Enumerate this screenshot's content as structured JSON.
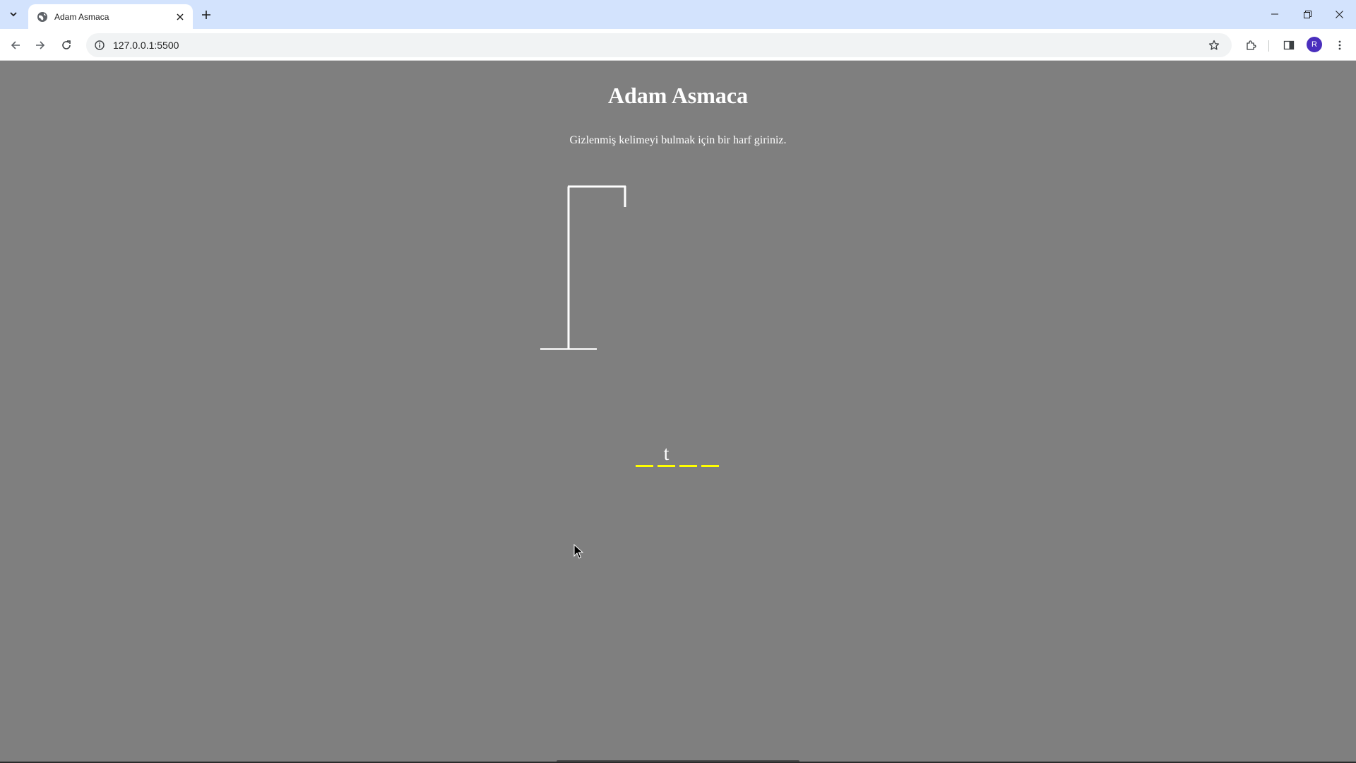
{
  "browser": {
    "tab_title": "Adam Asmaca",
    "url": "127.0.0.1:5500",
    "profile_initial": "R",
    "icons": {
      "tab_search": "chevron-down-icon",
      "favicon": "globe-icon",
      "tab_close": "close-icon",
      "new_tab": "plus-icon",
      "back": "arrow-left-icon",
      "forward": "arrow-right-icon",
      "reload": "reload-icon",
      "site_info": "info-icon",
      "bookmark": "star-icon",
      "extensions": "puzzle-icon",
      "side_panel": "side-panel-icon",
      "menu": "kebab-menu-icon",
      "minimize": "minimize-icon",
      "restore": "restore-icon",
      "close_window": "close-icon"
    }
  },
  "page": {
    "title": "Adam Asmaca",
    "instruction": "Gizlenmiş kelimeyi bulmak için bir harf giriniz.",
    "word_slots": [
      "",
      "t",
      "",
      ""
    ],
    "colors": {
      "background": "#7f7f7f",
      "text": "#ffffff",
      "slot_underline": "#ffff00",
      "gallows": "#ffffff"
    }
  }
}
